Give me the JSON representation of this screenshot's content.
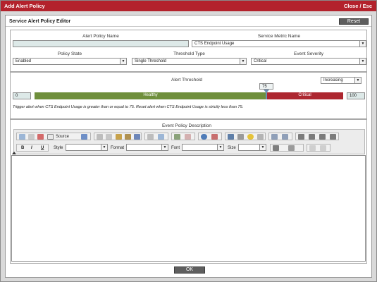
{
  "window": {
    "title": "Add Alert Policy",
    "close_label": "Close / Esc"
  },
  "panel": {
    "title": "Service Alert Policy Editor",
    "reset_label": "Reset"
  },
  "form": {
    "policy_name": {
      "label": "Alert Policy Name",
      "value": ""
    },
    "service_metric": {
      "label": "Service Metric Name",
      "value": "CTS Endpoint Usage"
    },
    "policy_state": {
      "label": "Policy State",
      "value": "Enabled"
    },
    "threshold_type": {
      "label": "Threshold Type",
      "value": "Single Threshold"
    },
    "event_severity": {
      "label": "Event Severity",
      "value": "Critical"
    }
  },
  "threshold": {
    "label": "Alert Threshold",
    "direction": "Increasing",
    "min": "0",
    "max": "100",
    "value": "75",
    "value_fraction": 0.75,
    "healthy_label": "Healthy",
    "critical_label": "Critical",
    "description": "Trigger alert when CTS Endpoint Usage is greater than or equal to 75. Reset alert when CTS Endpoint Usage is strictly less than 75."
  },
  "editor": {
    "label": "Event Policy Description",
    "source_label": "Source",
    "style_label": "Style",
    "format_label": "Format",
    "font_label": "Font",
    "size_label": "Size",
    "bold": "B",
    "italic": "I",
    "underline": "U"
  },
  "ok_label": "OK",
  "colors": {
    "title_bar": "#b3222c",
    "healthy": "#6f8f3c",
    "critical": "#ad2730"
  }
}
